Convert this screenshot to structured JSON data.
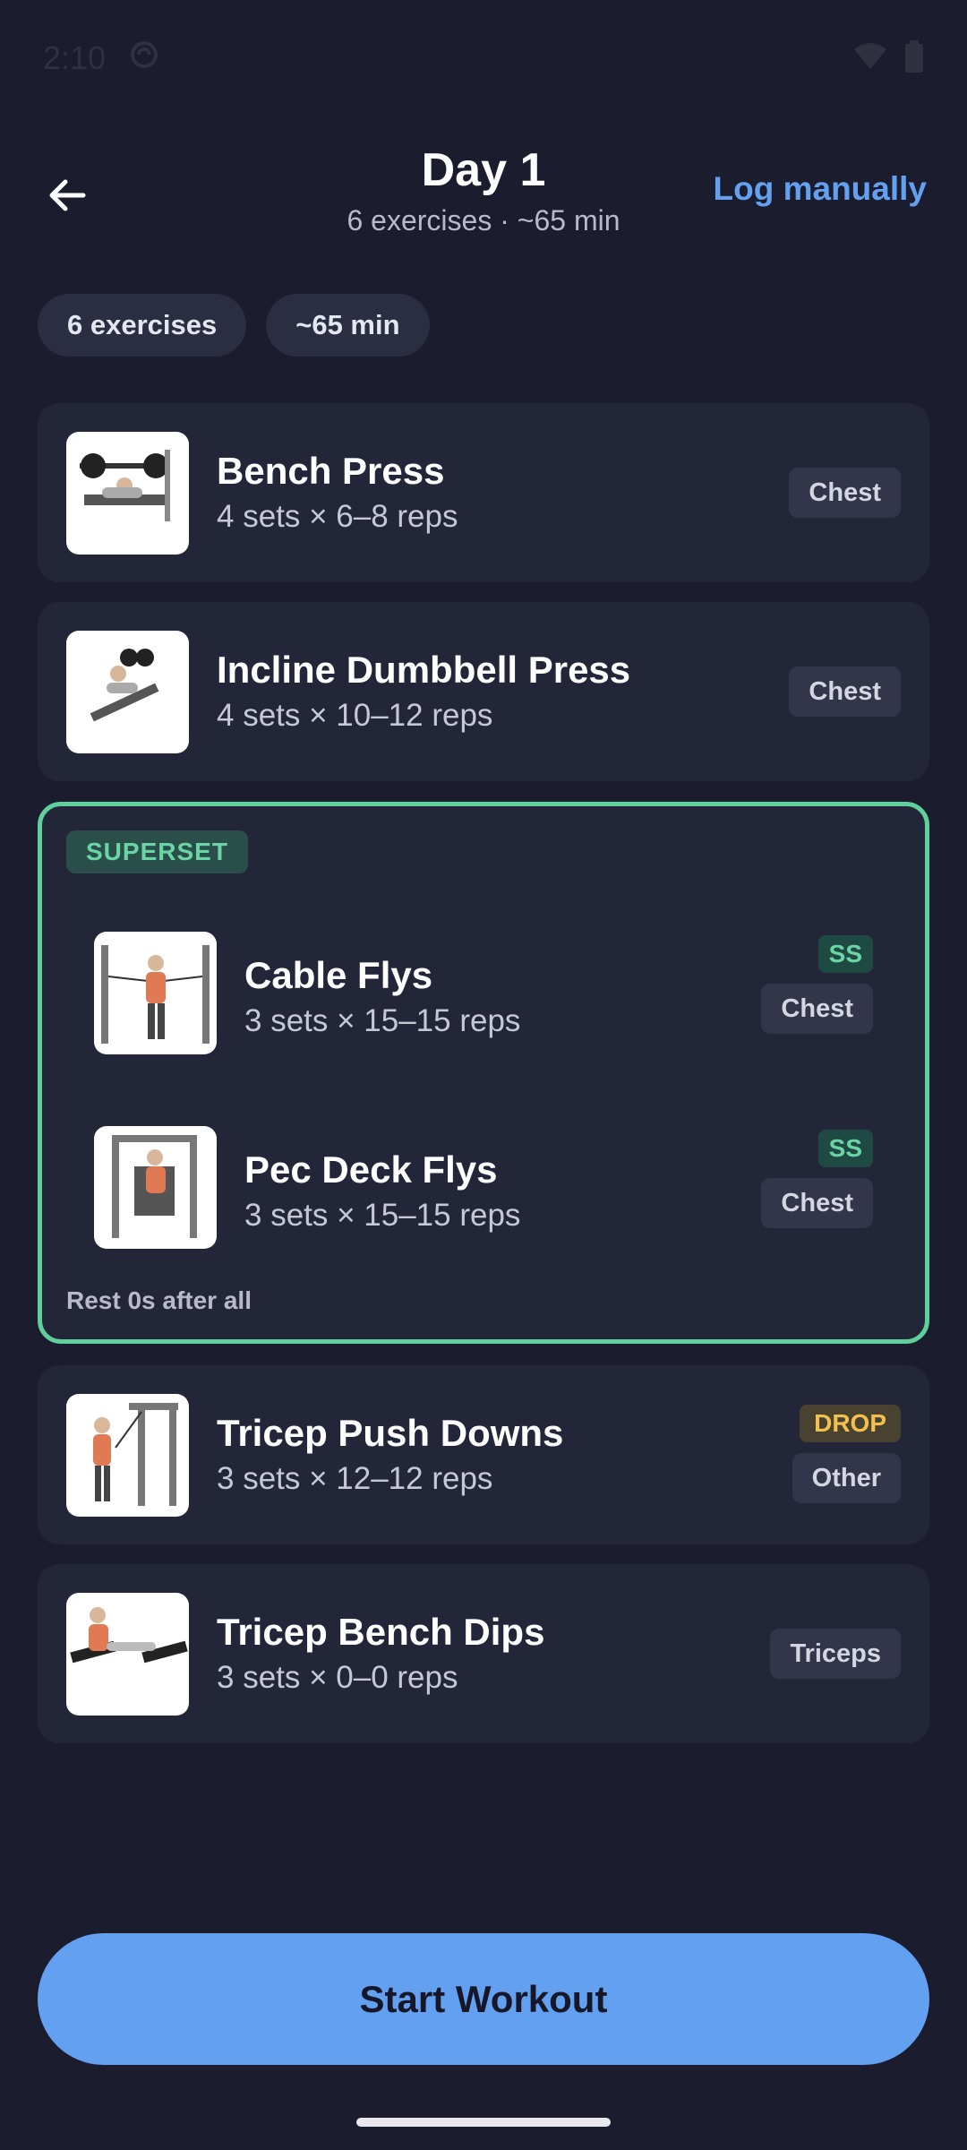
{
  "status_bar": {
    "time": "2:10"
  },
  "header": {
    "title": "Day 1",
    "subtitle": "6 exercises · ~65 min",
    "log_label": "Log manually"
  },
  "chips": [
    "6 exercises",
    "~65 min"
  ],
  "exercises": [
    {
      "name": "Bench Press",
      "detail": "4 sets × 6–8 reps",
      "tag": "Chest"
    },
    {
      "name": "Incline Dumbbell Press",
      "detail": "4 sets × 10–12 reps",
      "tag": "Chest"
    }
  ],
  "superset": {
    "label": "SUPERSET",
    "rest": "Rest 0s after all",
    "items": [
      {
        "name": "Cable Flys",
        "detail": "3 sets × 15–15 reps",
        "badge": "SS",
        "tag": "Chest"
      },
      {
        "name": "Pec Deck Flys",
        "detail": "3 sets × 15–15 reps",
        "badge": "SS",
        "tag": "Chest"
      }
    ]
  },
  "more_exercises": [
    {
      "name": "Tricep Push Downs",
      "detail": "3 sets × 12–12 reps",
      "badge": "DROP",
      "tag": "Other"
    },
    {
      "name": "Tricep Bench Dips",
      "detail": "3 sets × 0–0 reps",
      "tag": "Triceps"
    }
  ],
  "start_button": "Start Workout",
  "colors": {
    "background": "#1b1c2e",
    "card": "#232539",
    "accent_blue": "#63a0f0",
    "superset_green": "#5fcf9b",
    "drop_yellow": "#f2c04c"
  }
}
